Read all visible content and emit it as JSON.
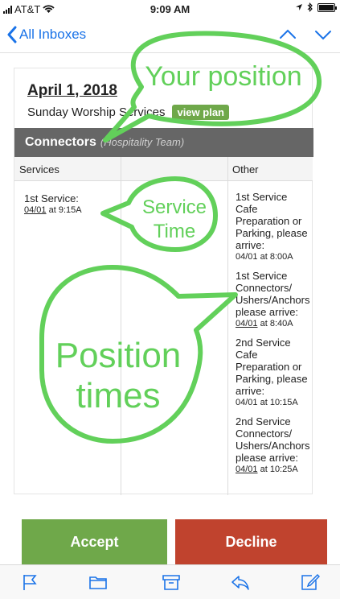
{
  "status_bar": {
    "carrier": "AT&T",
    "time": "9:09 AM"
  },
  "nav": {
    "back_label": "All Inboxes"
  },
  "email": {
    "title": "April 1, 2018",
    "subtitle": "Sunday Worship Services",
    "view_plan_label": "view plan",
    "team_name": "Connectors",
    "team_sub": "(Hospitality Team)",
    "columns": [
      "Services",
      "",
      "Other"
    ],
    "service_label": "1st Service:",
    "service_date": "04/01",
    "service_time": "at 9:15A",
    "other_items": [
      {
        "text": "1st Service Cafe Preparation or Parking, please arrive:",
        "date": "04/01",
        "time": "at 8:00A",
        "date_underlined": false
      },
      {
        "text": "1st Service Connectors/ Ushers/Anchors please arrive:",
        "date": "04/01",
        "time": "at 8:40A",
        "date_underlined": true
      },
      {
        "text": "2nd Service Cafe Preparation or Parking, please arrive:",
        "date": "04/01",
        "time": "at 10:15A",
        "date_underlined": false
      },
      {
        "text": "2nd Service Connectors/ Ushers/Anchors please arrive:",
        "date": "04/01",
        "time": "at 10:25A",
        "date_underlined": true
      }
    ]
  },
  "actions": {
    "accept_label": "Accept",
    "decline_label": "Decline"
  },
  "annotations": {
    "your_position": "Your position",
    "service_time_line1": "Service",
    "service_time_line2": "Time",
    "position_times_line1": "Position",
    "position_times_line2": "times",
    "color": "#62d05a"
  },
  "colors": {
    "accent": "#1a73e8",
    "accept": "#6fa84a",
    "decline": "#c0432e",
    "header": "#666666"
  },
  "toolbar": {
    "icons": [
      "flag-icon",
      "folder-icon",
      "archive-icon",
      "reply-icon",
      "compose-icon"
    ]
  }
}
